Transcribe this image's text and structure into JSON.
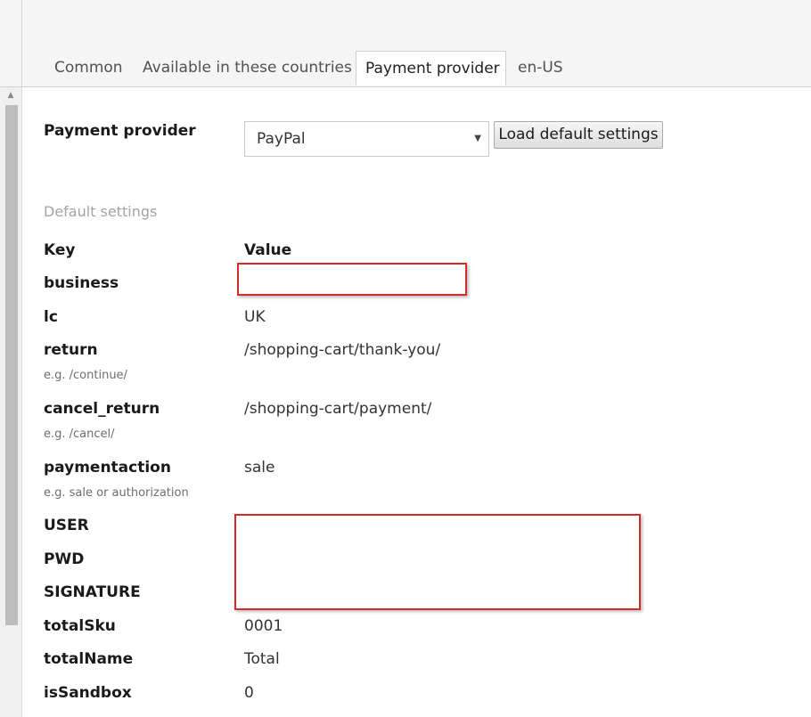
{
  "tabs": [
    {
      "label": "Common"
    },
    {
      "label": "Available in these countries"
    },
    {
      "label": "Payment provider"
    },
    {
      "label": "en-US"
    }
  ],
  "payment_provider": {
    "label": "Payment provider",
    "selected": "PayPal",
    "load_button": "Load default settings"
  },
  "default_settings": {
    "title": "Default settings",
    "key_header": "Key",
    "value_header": "Value",
    "rows": [
      {
        "key": "business",
        "value": "",
        "hint": ""
      },
      {
        "key": "lc",
        "value": "UK",
        "hint": ""
      },
      {
        "key": "return",
        "value": "/shopping-cart/thank-you/",
        "hint": "e.g. /continue/"
      },
      {
        "key": "cancel_return",
        "value": "/shopping-cart/payment/",
        "hint": "e.g. /cancel/"
      },
      {
        "key": "paymentaction",
        "value": "sale",
        "hint": "e.g. sale or authorization"
      },
      {
        "key": "USER",
        "value": "",
        "hint": ""
      },
      {
        "key": "PWD",
        "value": "",
        "hint": ""
      },
      {
        "key": "SIGNATURE",
        "value": "",
        "hint": ""
      },
      {
        "key": "totalSku",
        "value": "0001",
        "hint": ""
      },
      {
        "key": "totalName",
        "value": "Total",
        "hint": ""
      },
      {
        "key": "isSandbox",
        "value": "0",
        "hint": ""
      }
    ]
  }
}
